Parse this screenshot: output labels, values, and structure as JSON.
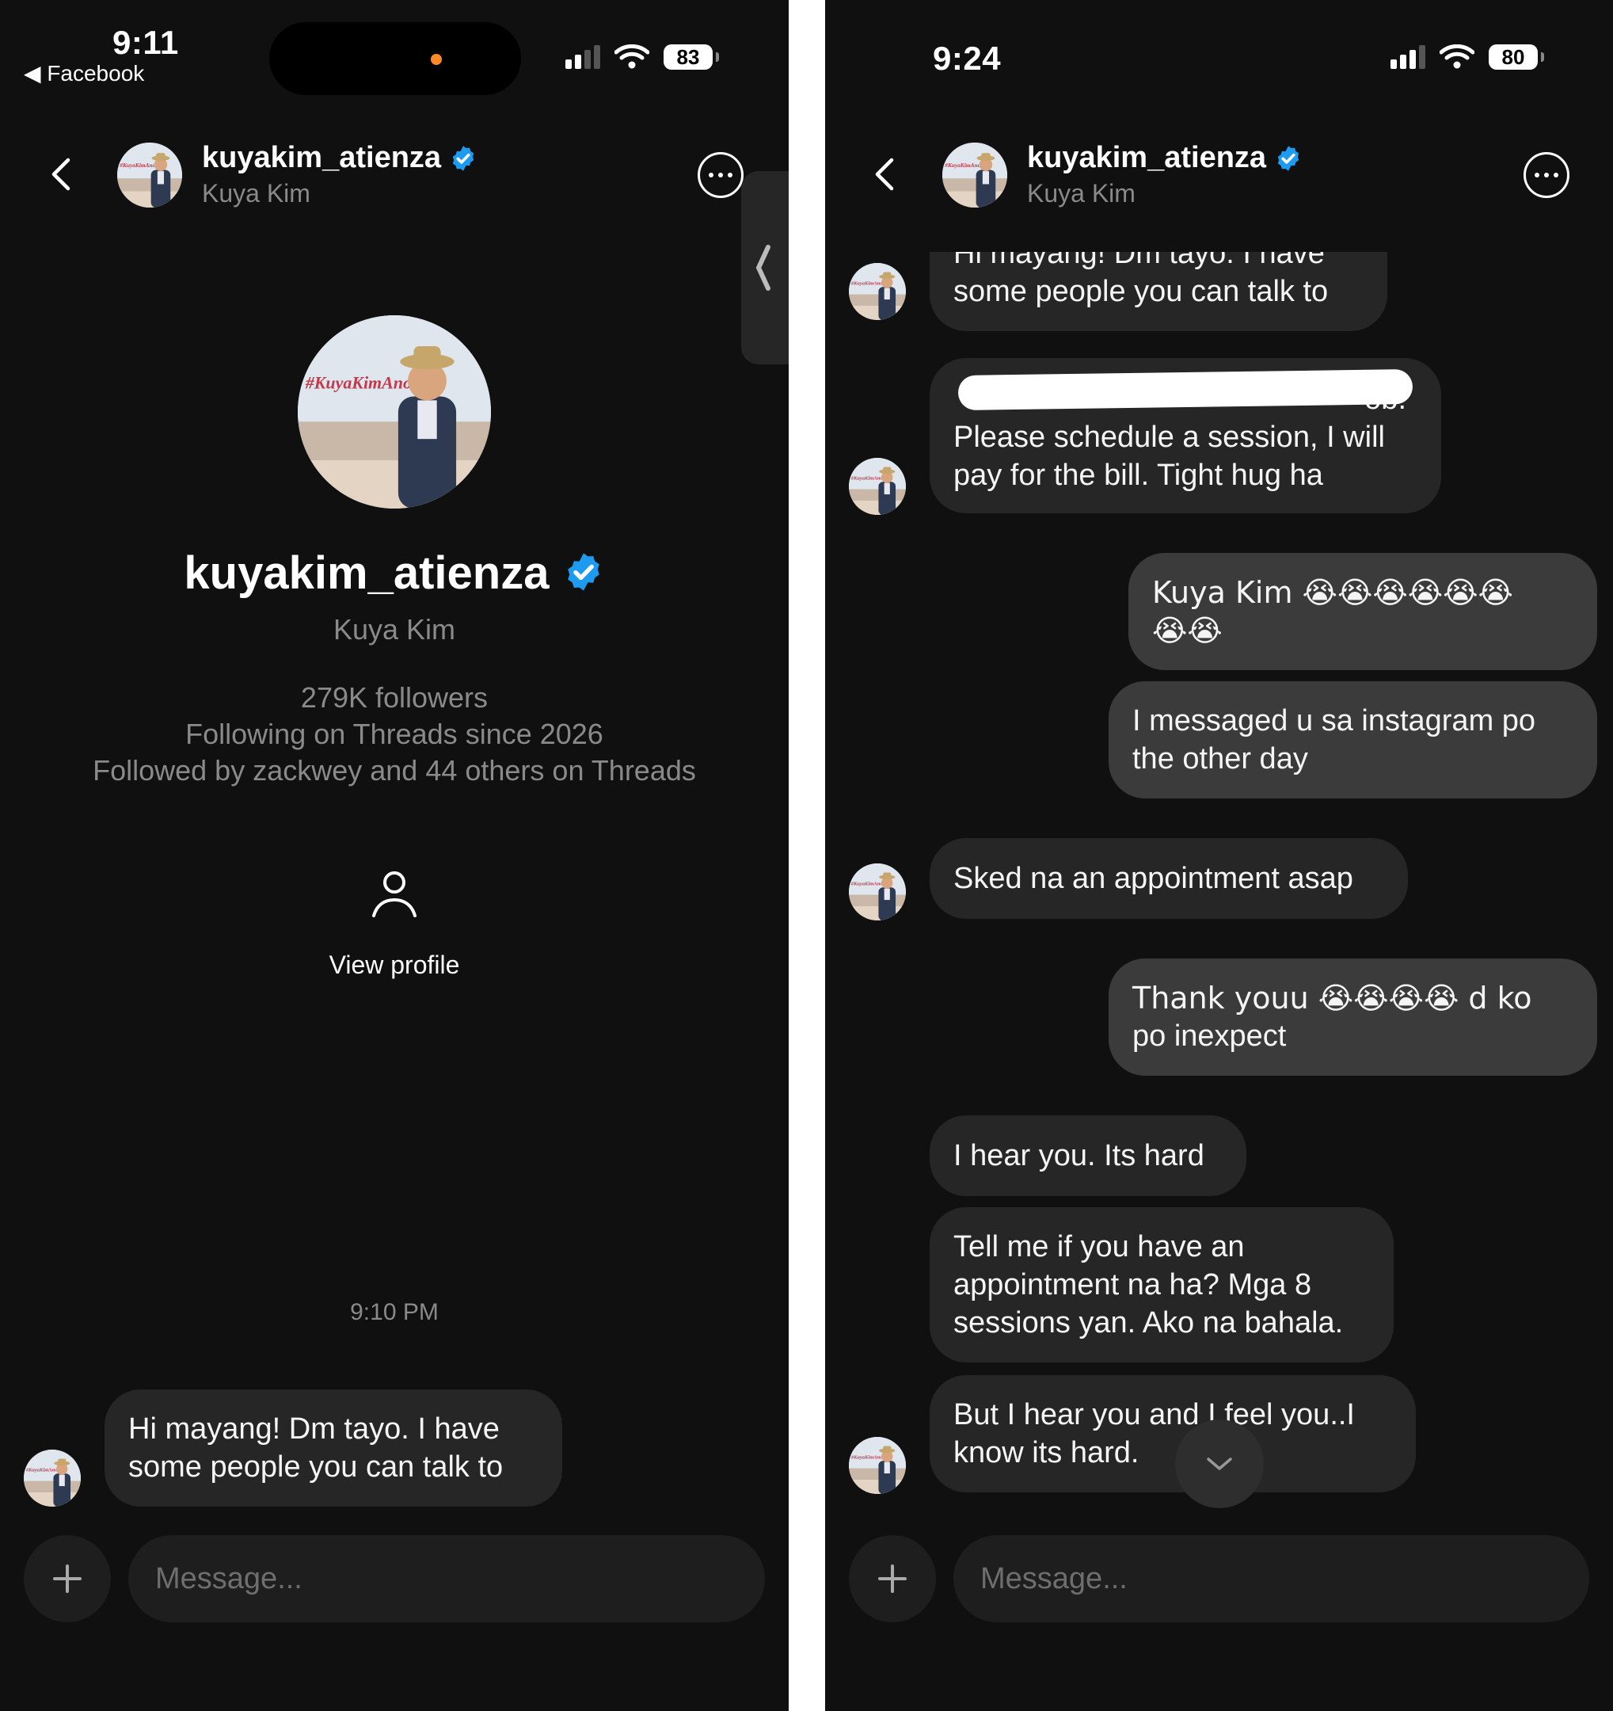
{
  "left": {
    "status": {
      "time": "9:11",
      "back_app": "◀ Facebook",
      "battery": "83"
    },
    "header": {
      "username": "kuyakim_atienza",
      "display_name": "Kuya Kim"
    },
    "profile": {
      "username": "kuyakim_atienza",
      "display_name": "Kuya Kim",
      "followers": "279K followers",
      "following_since": "Following on Threads since 2026",
      "followed_by": "Followed by zackwey and 44 others on Threads",
      "view_profile_label": "View profile"
    },
    "timestamp": "9:10 PM",
    "messages": [
      {
        "line1": "Hi mayang! Dm tayo. I have",
        "line2": "some people you can talk to"
      }
    ],
    "composer": {
      "placeholder": "Message..."
    }
  },
  "right": {
    "status": {
      "time": "9:24",
      "battery": "80"
    },
    "header": {
      "username": "kuyakim_atienza",
      "display_name": "Kuya Kim"
    },
    "messages": {
      "m1_clipped": "Hi mayang! Dm tayo. I have",
      "m1_line2": "some people you can talk to",
      "m2_tail": "ob.",
      "m2_line2": "Please schedule a session, I will",
      "m2_line3": "pay for the bill. Tight hug ha",
      "m3_line1": "Kuya Kim 😭😭😭😭😭😭",
      "m3_line2": "😭😭",
      "m4_line1": "I messaged u sa instagram po",
      "m4_line2": "the other day",
      "m5": "Sked na an appointment asap",
      "m6_line1": "Thank youu 😭😭😭😭 d ko",
      "m6_line2": "po inexpect",
      "m7": "I hear you. Its hard",
      "m8_line1": "Tell me if you have an",
      "m8_line2": "appointment na ha? Mga 8",
      "m8_line3": "sessions yan. Ako na bahala.",
      "m9_line1": "But I hear you and I feel you..I",
      "m9_line2": "know its hard."
    },
    "composer": {
      "placeholder": "Message..."
    }
  },
  "colors": {
    "background": "#101010",
    "incoming_bubble": "#262626",
    "outgoing_bubble": "#3b3b3b",
    "verified_badge": "#1d9bf0",
    "secondary_text": "#8a8a8a",
    "status_dot": "#ff8a2a"
  },
  "icons": [
    "back-chevron-icon",
    "verified-badge-icon",
    "more-options-icon",
    "person-icon",
    "plus-icon",
    "chevron-down-icon",
    "wifi-icon",
    "signal-icon",
    "battery-icon"
  ]
}
